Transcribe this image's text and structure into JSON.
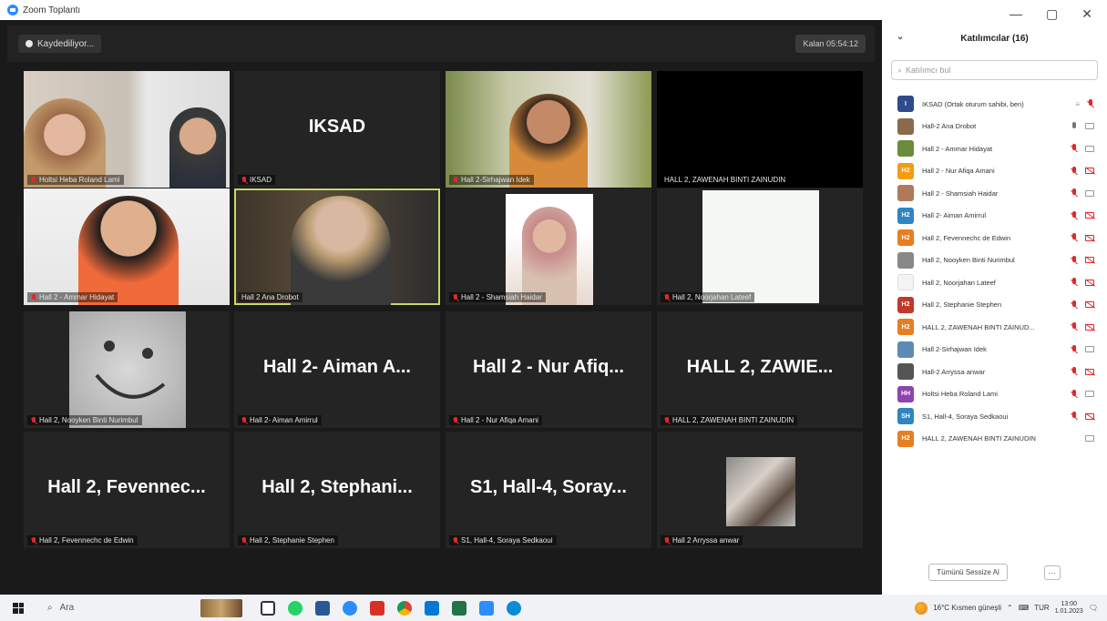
{
  "window": {
    "title": "Zoom Toplantı",
    "min": "—",
    "max": "▢",
    "close": "✕"
  },
  "stage": {
    "recording_label": "Kaydediliyor...",
    "timer_label": "Kalan 05:54:12"
  },
  "tiles": [
    {
      "name": "Holtsi Heba Roland Lami",
      "big": "",
      "kind": "video-couple",
      "muted": true
    },
    {
      "name": "IKSAD",
      "big": "IKSAD",
      "kind": "name",
      "muted": true
    },
    {
      "name": "Hall 2-Sirhajwan Idek",
      "big": "",
      "kind": "video-man",
      "muted": true
    },
    {
      "name": "HALL 2, ZAWENAH BINTI ZAINUDIN",
      "big": "",
      "kind": "black",
      "muted": false
    },
    {
      "name": "Hall 2 - Ammar Hidayat",
      "big": "",
      "kind": "video-boy",
      "muted": true
    },
    {
      "name": "Hall 2 Ana Drobot",
      "big": "",
      "kind": "video-woman",
      "muted": false,
      "active": true
    },
    {
      "name": "Hall 2 - Shamsiah Haidar",
      "big": "",
      "kind": "video-hijab",
      "muted": true
    },
    {
      "name": "Hall 2, Noorjahan Lateef",
      "big": "",
      "kind": "white",
      "muted": true
    },
    {
      "name": "Hall 2, Nooyken Binti Nurimbul",
      "big": "",
      "kind": "smiley",
      "muted": true
    },
    {
      "name": "Hall 2- Aiman Amirrul",
      "big": "Hall 2- Aiman A...",
      "kind": "name",
      "muted": true
    },
    {
      "name": "Hall 2 - Nur Afiqa Amani",
      "big": "Hall 2 - Nur Afiq...",
      "kind": "name",
      "muted": true
    },
    {
      "name": "HALL 2, ZAWENAH BINTI ZAINUDIN",
      "big": "HALL 2, ZAWIE...",
      "kind": "name",
      "muted": true
    },
    {
      "name": "Hall 2, Fevennechc de Edwin",
      "big": "Hall 2, Fevennec...",
      "kind": "name",
      "muted": true
    },
    {
      "name": "Hall 2, Stephanie Stephen",
      "big": "Hall 2, Stephani...",
      "kind": "name",
      "muted": true
    },
    {
      "name": "S1, Hall-4, Soraya Sedkaoui",
      "big": "S1, Hall-4, Soray...",
      "kind": "name",
      "muted": true
    },
    {
      "name": "Hall 2 Arryssa anwar",
      "big": "",
      "kind": "small-photo",
      "muted": true
    }
  ],
  "panel": {
    "title": "Katılımcılar (16)",
    "search_placeholder": "Katılımcı bul",
    "participants": [
      {
        "initials": "I",
        "color": "#2e4b8c",
        "name": "IKSAD (Ortak oturum sahibi, ben)",
        "mic": "muted",
        "cam": "none",
        "extra": "≡"
      },
      {
        "initials": "",
        "color": "#8a6a4c",
        "name": "Hall-2 Ana Drobot",
        "mic": "on",
        "cam": "on"
      },
      {
        "initials": "",
        "color": "#6b8c3a",
        "name": "Hall 2 - Ammar Hidayat",
        "mic": "muted",
        "cam": "on"
      },
      {
        "initials": "H2",
        "color": "#f39c12",
        "name": "Hall 2 - Nur Afiqa Amani",
        "mic": "muted",
        "cam": "off"
      },
      {
        "initials": "",
        "color": "#b07a5a",
        "name": "Hall 2 - Shamsiah Haidar",
        "mic": "muted",
        "cam": "on"
      },
      {
        "initials": "H2",
        "color": "#2e86c1",
        "name": "Hall 2- Aiman Amirrul",
        "mic": "muted",
        "cam": "off"
      },
      {
        "initials": "H2",
        "color": "#e67e22",
        "name": "Hall 2, Fevennechc de Edwin",
        "mic": "muted",
        "cam": "off"
      },
      {
        "initials": "",
        "color": "#888888",
        "name": "Hall 2, Nooyken Binti Nurimbul",
        "mic": "muted",
        "cam": "off"
      },
      {
        "initials": "",
        "color": "#f4f4f4",
        "name": "Hall 2, Noorjahan Lateef",
        "mic": "muted",
        "cam": "off"
      },
      {
        "initials": "H2",
        "color": "#c0392b",
        "name": "Hall 2, Stephanie Stephen",
        "mic": "muted",
        "cam": "off"
      },
      {
        "initials": "H2",
        "color": "#e67e22",
        "name": "HALL 2, ZAWENAH BINTI ZAINUD...",
        "mic": "muted",
        "cam": "off"
      },
      {
        "initials": "",
        "color": "#5d8bb5",
        "name": "Hall 2-Sirhajwan Idek",
        "mic": "muted",
        "cam": "on"
      },
      {
        "initials": "",
        "color": "#555555",
        "name": "Hall-2 Arryssa anwar",
        "mic": "muted",
        "cam": "off"
      },
      {
        "initials": "HH",
        "color": "#8e44ad",
        "name": "Holtsi Heba Roland Lami",
        "mic": "muted",
        "cam": "on"
      },
      {
        "initials": "SH",
        "color": "#2e86c1",
        "name": "S1, Hall-4, Soraya Sedkaoui",
        "mic": "muted",
        "cam": "off"
      },
      {
        "initials": "H2",
        "color": "#e67e22",
        "name": "HALL 2, ZAWENAH BINTI ZAINUDIN",
        "mic": "none",
        "cam": "on"
      }
    ],
    "mute_all_label": "Tümünü Sessize Al",
    "more_label": "···"
  },
  "taskbar": {
    "search_label": "Ara",
    "weather": "16°C Kısmen güneşli",
    "lang": "TUR",
    "time": "13:00",
    "date": "1.01.2023"
  }
}
